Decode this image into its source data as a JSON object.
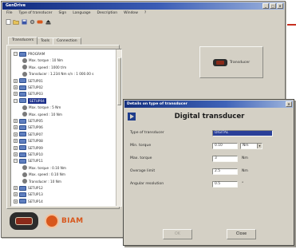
{
  "app": {
    "title": "GenDrive",
    "menu": [
      "File",
      "Type of transducer",
      "Sign",
      "Language",
      "Description",
      "Window",
      "?"
    ]
  },
  "left_panel": {
    "tabs": [
      "Transducers",
      "Tools",
      "Connection"
    ],
    "tree": [
      {
        "text": "PROGRAM",
        "kind": "node",
        "level": 1,
        "toggle": "-"
      },
      {
        "text": "Max. torque : 10 Nm",
        "kind": "leaf",
        "level": 2
      },
      {
        "text": "Max. speed : 1000 t/m",
        "kind": "leaf",
        "level": 2
      },
      {
        "text": "Transducer : 1.234 Nm s/n : 1 000.00 s",
        "kind": "leaf",
        "level": 2
      },
      {
        "text": "SETUP01",
        "kind": "node",
        "level": 1,
        "toggle": "+"
      },
      {
        "text": "SETUP02",
        "kind": "node",
        "level": 1,
        "toggle": "+"
      },
      {
        "text": "SETUP03",
        "kind": "node",
        "level": 1,
        "toggle": "+"
      },
      {
        "text": "SETUP04",
        "kind": "node",
        "level": 1,
        "toggle": "-",
        "selected": true
      },
      {
        "text": "Max. torque : 5 Nm",
        "kind": "leaf",
        "level": 2
      },
      {
        "text": "Max. speed : 10 Nm",
        "kind": "leaf",
        "level": 2
      },
      {
        "text": "SETUP05",
        "kind": "node",
        "level": 1,
        "toggle": "+"
      },
      {
        "text": "SETUP06",
        "kind": "node",
        "level": 1,
        "toggle": "+"
      },
      {
        "text": "SETUP07",
        "kind": "node",
        "level": 1,
        "toggle": "+"
      },
      {
        "text": "SETUP08",
        "kind": "node",
        "level": 1,
        "toggle": "+"
      },
      {
        "text": "SETUP09",
        "kind": "node",
        "level": 1,
        "toggle": "+"
      },
      {
        "text": "SETUP10",
        "kind": "node",
        "level": 1,
        "toggle": "+"
      },
      {
        "text": "SETUP11",
        "kind": "node",
        "level": 1,
        "toggle": "-"
      },
      {
        "text": "Max. torque : 0.10 Nm",
        "kind": "leaf",
        "level": 2
      },
      {
        "text": "Max. speed : 0.10 Nm",
        "kind": "leaf",
        "level": 2
      },
      {
        "text": "Transducer : 10 Nm",
        "kind": "leaf",
        "level": 2
      },
      {
        "text": "SETUP12",
        "kind": "node",
        "level": 1,
        "toggle": "+"
      },
      {
        "text": "SETUP13",
        "kind": "node",
        "level": 1,
        "toggle": "+"
      },
      {
        "text": "SETUP14",
        "kind": "node",
        "level": 1,
        "toggle": "+"
      }
    ],
    "brand": "BIAM"
  },
  "right_area": {
    "transducer_button": "Transducer"
  },
  "dialog": {
    "title": "Details on type of transducer",
    "heading": "Digital transducer",
    "fields": [
      {
        "label": "Type of transducer",
        "value": "DIGITAL",
        "unit": "",
        "has_select": false,
        "selected": true
      },
      {
        "label": "Min. torque",
        "value": "0.10",
        "unit": "Nm",
        "has_select": true
      },
      {
        "label": "Max. torque",
        "value": "3",
        "unit": "Nm",
        "has_select": false
      },
      {
        "label": "Overage limit",
        "value": "2.5",
        "unit": "Nm",
        "has_select": false
      },
      {
        "label": "Angular resolution",
        "value": "0.5",
        "unit": "°",
        "has_select": false
      }
    ],
    "buttons": {
      "ok": "OK",
      "close": "Close"
    }
  },
  "colors": {
    "title_bar": "#1a3585",
    "window_face": "#d4d0c5",
    "selection": "#1c2f8a",
    "brand": "#d8571c",
    "accent_mark": "#c83020"
  }
}
